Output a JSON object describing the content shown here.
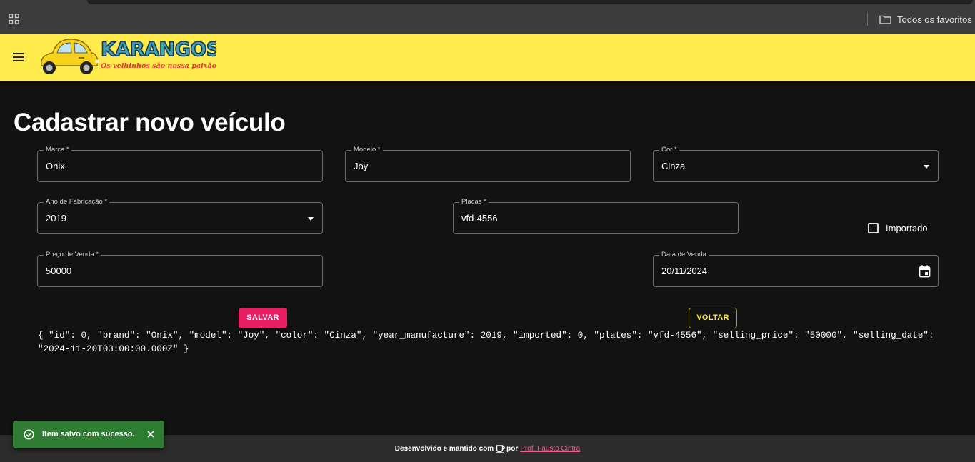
{
  "browser": {
    "bookmarks_label": "Todos os favoritos"
  },
  "header": {
    "logo_title": "KARANGOS",
    "logo_slogan": "Os velhinhos são nossa paixão",
    "brand_color": "#ffeb4c"
  },
  "page": {
    "title": "Cadastrar novo veículo"
  },
  "form": {
    "brand": {
      "label": "Marca *",
      "value": "Onix"
    },
    "model": {
      "label": "Modelo *",
      "value": "Joy"
    },
    "color": {
      "label": "Cor *",
      "value": "Cinza"
    },
    "year": {
      "label": "Ano de Fabricação *",
      "value": "2019"
    },
    "plates": {
      "label": "Placas *",
      "value": "vfd-4556"
    },
    "imported": {
      "label": "Importado",
      "checked": false
    },
    "price": {
      "label": "Preço de Venda *",
      "value": "50000"
    },
    "selling_date": {
      "label": "Data de Venda",
      "value": "20/11/2024"
    },
    "save_label": "SALVAR",
    "back_label": "VOLTAR",
    "json_output": "{ \"id\": 0, \"brand\": \"Onix\", \"model\": \"Joy\", \"color\": \"Cinza\", \"year_manufacture\": 2019, \"imported\": 0, \"plates\": \"vfd-4556\", \"selling_price\": \"50000\", \"selling_date\": \"2024-11-20T03:00:00.000Z\" }"
  },
  "snackbar": {
    "message": "Item salvo com sucesso."
  },
  "footer": {
    "text": "Desenvolvido e mantido com",
    "by": "por",
    "author": "Prof. Fausto Cintra"
  }
}
